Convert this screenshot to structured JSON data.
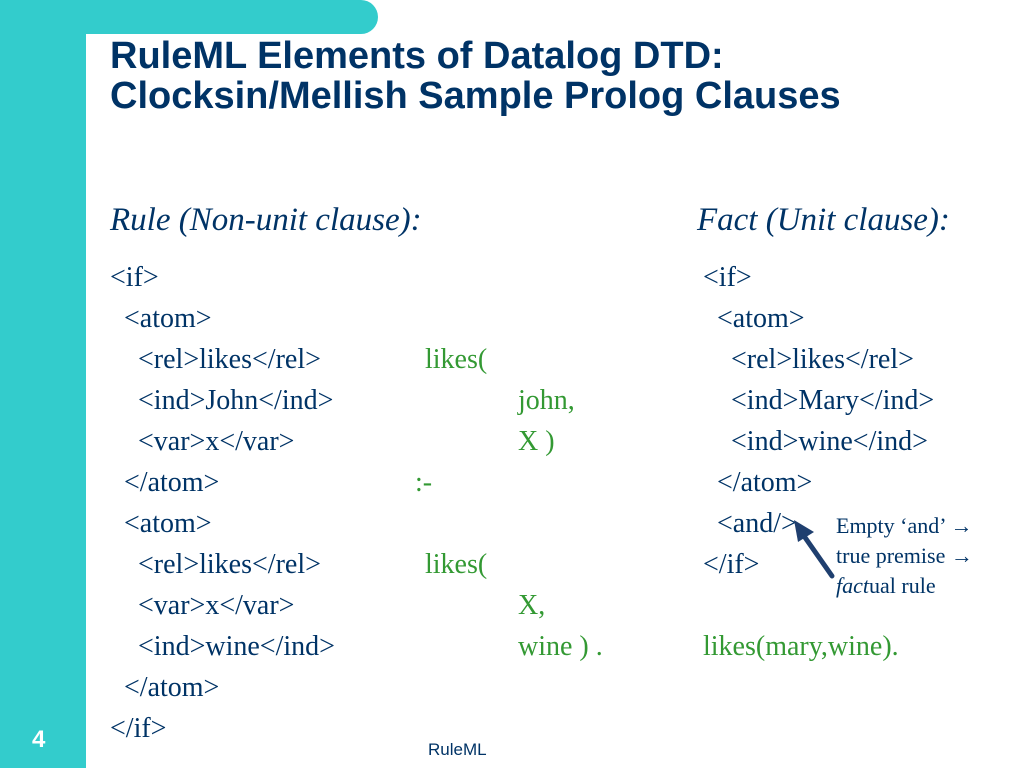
{
  "title": {
    "line1": "RuleML Elements of Datalog DTD:",
    "line2": "Clocksin/Mellish Sample Prolog Clauses"
  },
  "rule": {
    "heading": "Rule (Non-unit clause):",
    "xml": [
      "<if>",
      "  <atom>",
      "    <rel>likes</rel>",
      "    <ind>John</ind>",
      "    <var>x</var>",
      "  </atom>",
      "  <atom>",
      "    <rel>likes</rel>",
      "    <var>x</var>",
      "    <ind>wine</ind>",
      "  </atom>",
      "</if>"
    ],
    "prolog": {
      "likes1": "likes(",
      "john": "john,",
      "x1": "X )",
      "neck": ":-",
      "likes2": "likes(",
      "x2": "X,",
      "wine": "wine ) ."
    }
  },
  "fact": {
    "heading": "Fact (Unit clause):",
    "xml": [
      "<if>",
      "  <atom>",
      "    <rel>likes</rel>",
      "    <ind>Mary</ind>",
      "    <ind>wine</ind>",
      "  </atom>",
      "  <and/>",
      "</if>"
    ],
    "prolog": "likes(mary,wine).",
    "annotation": {
      "line1": "Empty ‘and’ →",
      "line2": "true premise →",
      "line3_em": "fact",
      "line3_rest": "ual rule"
    }
  },
  "slide_number": "4",
  "footer": "RuleML",
  "colors": {
    "accent": "#33cccc",
    "title": "#003366",
    "prolog": "#339933"
  }
}
